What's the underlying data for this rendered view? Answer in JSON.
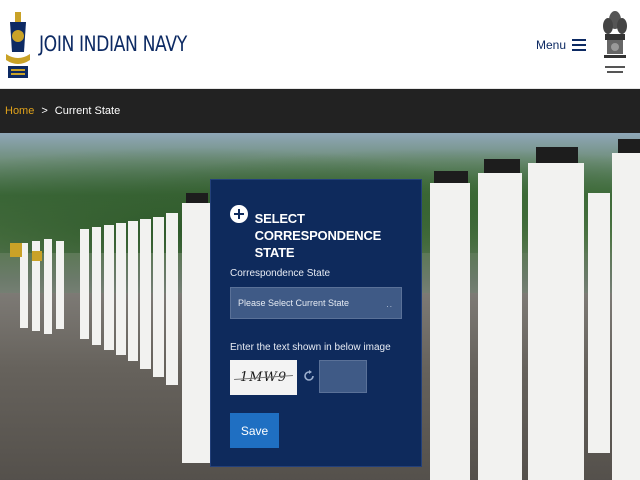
{
  "header": {
    "brand_title": "JOIN INDIAN NAVY",
    "logo_icon": "navy-crest-icon",
    "emblem_icon": "national-emblem-icon",
    "menu_label": "Menu",
    "menu_icon": "hamburger-icon",
    "brand_color": "#0d2a63"
  },
  "breadcrumb": {
    "home": "Home",
    "separator": ">",
    "current": "Current State",
    "home_color": "#e0a21b"
  },
  "form": {
    "title_line1": "SELECT",
    "title_line2": "CORRESPONDENCE STATE",
    "state_label": "Correspondence State",
    "state_selected": "Please Select Current State",
    "state_caret": "..",
    "captcha_label": "Enter the text shown in below image",
    "captcha_text": "1MW9",
    "captcha_value": "",
    "save_label": "Save",
    "panel_color": "#0e2a5c",
    "button_color": "#1f6fc2"
  }
}
